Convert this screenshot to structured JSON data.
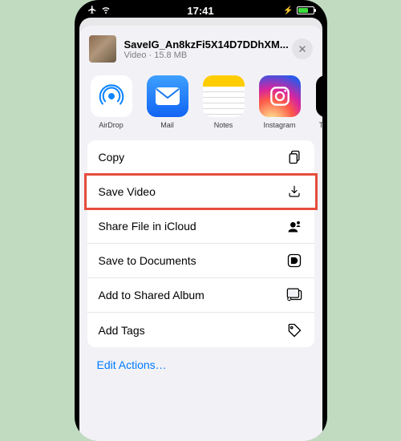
{
  "statusbar": {
    "time": "17:41"
  },
  "file": {
    "name": "SaveIG_An8kzFi5X14D7DDhXM...",
    "meta": "Video · 15.8 MB"
  },
  "apps": [
    {
      "label": "AirDrop"
    },
    {
      "label": "Mail"
    },
    {
      "label": "Notes"
    },
    {
      "label": "Instagram"
    },
    {
      "label": "T"
    }
  ],
  "actions": [
    {
      "label": "Copy"
    },
    {
      "label": "Save Video"
    },
    {
      "label": "Share File in iCloud"
    },
    {
      "label": "Save to Documents"
    },
    {
      "label": "Add to Shared Album"
    },
    {
      "label": "Add Tags"
    }
  ],
  "edit_label": "Edit Actions…",
  "highlighted_index": 1
}
